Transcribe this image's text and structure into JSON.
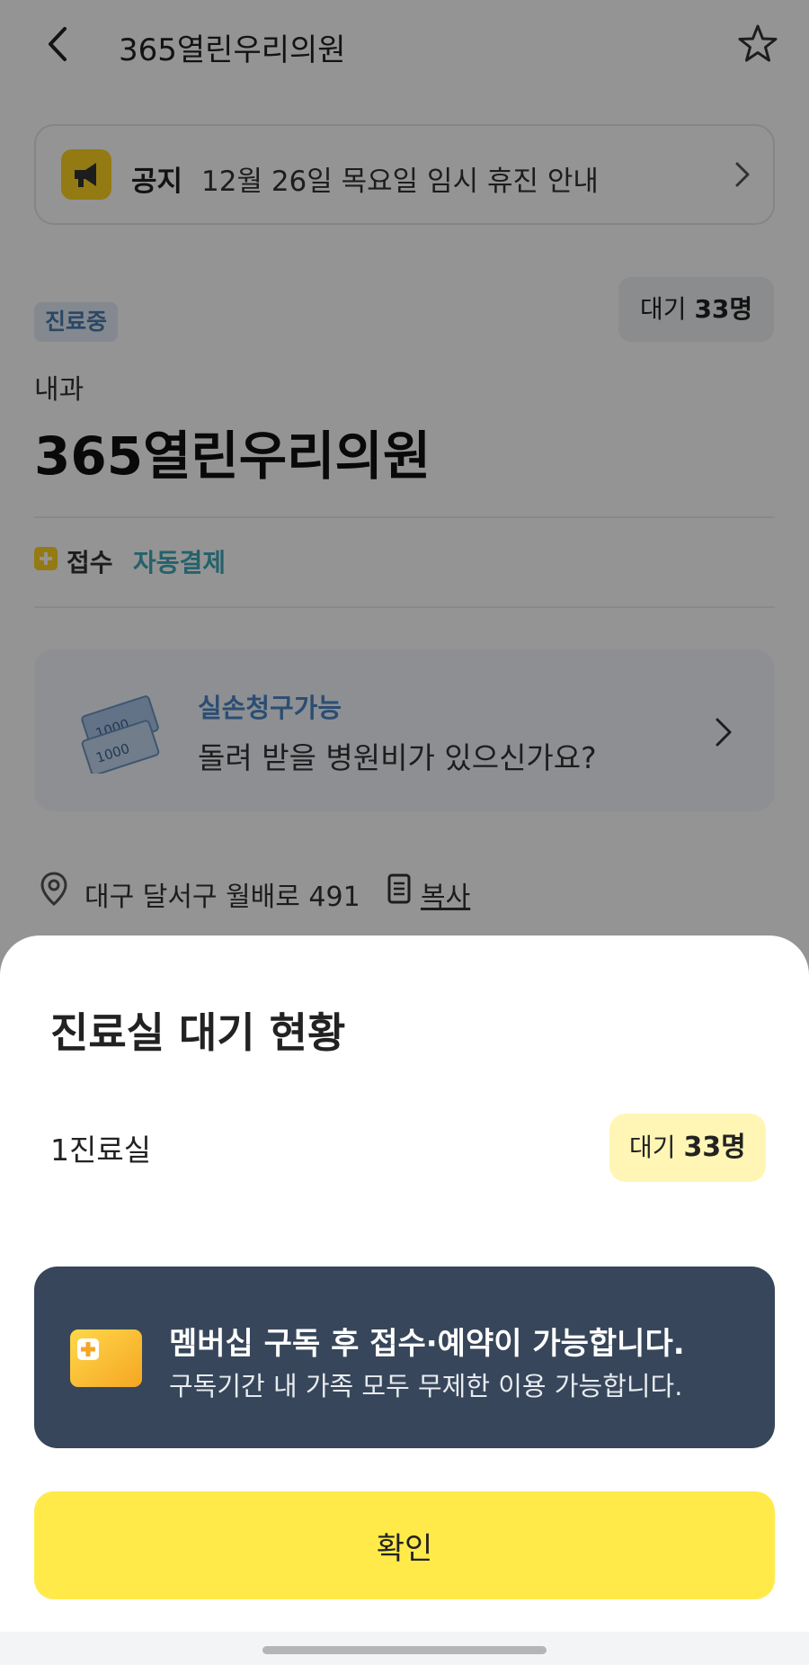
{
  "header": {
    "title": "365열린우리의원"
  },
  "notice": {
    "label": "공지",
    "text": "12월 26일 목요일 임시 휴진 안내"
  },
  "clinic": {
    "status": "진료중",
    "wait_prefix": "대기",
    "wait_count": "33명",
    "department": "내과",
    "name": "365열린우리의원",
    "reception_label": "접수",
    "autopay_label": "자동결제"
  },
  "insurance": {
    "title": "실손청구가능",
    "text": "돌려 받을 병원비가 있으신가요?",
    "money_label_1": "1000",
    "money_label_2": "1000"
  },
  "address": {
    "text": "대구 달서구 월배로 491",
    "copy_label": "복사"
  },
  "sheet": {
    "title": "진료실 대기 현황",
    "rooms": [
      {
        "name": "1진료실",
        "wait_prefix": "대기",
        "wait_count": "33명"
      }
    ],
    "membership": {
      "title": "멤버십 구독 후 접수·예약이 가능합니다.",
      "subtitle": "구독기간 내 가족 모두 무제한 이용 가능합니다."
    },
    "confirm_label": "확인"
  },
  "colors": {
    "accent_yellow": "#ffea4a",
    "badge_yellow": "#fff6b5",
    "banner_navy": "#37465a",
    "status_blue": "#4b7ab0",
    "autopay_teal": "#3fa9b8"
  },
  "icons": [
    "back-icon",
    "star-icon",
    "megaphone-icon",
    "chevron-right-icon",
    "money-icon",
    "location-pin-icon",
    "copy-icon",
    "membership-card-icon"
  ]
}
